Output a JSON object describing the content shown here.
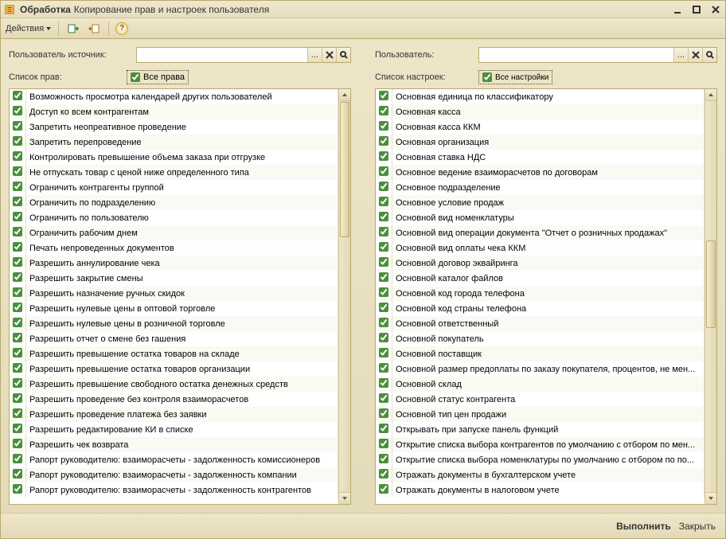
{
  "window": {
    "title": "Обработка",
    "subtitle": "Копирование прав и настроек пользователя"
  },
  "toolbar": {
    "actions_label": "Действия"
  },
  "left": {
    "user_label": "Пользователь источник:",
    "list_label": "Список прав:",
    "all_label": "Все права",
    "items": [
      "Возможность просмотра календарей других пользователей",
      "Доступ ко всем контрагентам",
      "Запретить неопреативное проведение",
      "Запретить перепроведение",
      "Контролировать превышение объема заказа при отгрузке",
      "Не отпускать товар с ценой ниже определенного типа",
      "Ограничить контрагенты группой",
      "Ограничить по подразделению",
      "Ограничить по пользователю",
      "Ограничить рабочим днем",
      "Печать непроведенных документов",
      "Разрешить аннулирование чека",
      "Разрешить закрытие смены",
      "Разрешить назначение ручных скидок",
      "Разрешить нулевые цены в оптовой торговле",
      "Разрешить нулевые цены в розничной торговле",
      "Разрешить отчет о смене без гашения",
      "Разрешить превышение остатка товаров на складе",
      "Разрешить превышение остатка товаров организации",
      "Разрешить превышение свободного остатка денежных средств",
      "Разрешить проведение без контроля взаиморасчетов",
      "Разрешить проведение платежа без заявки",
      "Разрешить редактирование КИ в списке",
      "Разрешить чек возврата",
      "Рапорт руководителю: взаиморасчеты - задолженность комиссионеров",
      "Рапорт руководителю: взаиморасчеты - задолженность компании",
      "Рапорт руководителю: взаиморасчеты - задолженность контрагентов"
    ]
  },
  "right": {
    "user_label": "Пользователь:",
    "list_label": "Список настроек:",
    "all_label": "Все настройки",
    "items": [
      "Основная единица по классификатору",
      "Основная касса",
      "Основная касса ККМ",
      "Основная организация",
      "Основная ставка НДС",
      "Основное ведение взаиморасчетов по договорам",
      "Основное подразделение",
      "Основное условие продаж",
      "Основной вид номенклатуры",
      "Основной вид операции документа \"Отчет о розничных продажах\"",
      "Основной вид оплаты чека ККМ",
      "Основной договор эквайринга",
      "Основной каталог файлов",
      "Основной код города телефона",
      "Основной код страны телефона",
      "Основной ответственный",
      "Основной покупатель",
      "Основной поставщик",
      "Основной размер предоплаты по заказу покупателя, процентов, не мен...",
      "Основной склад",
      "Основной статус контрагента",
      "Основной тип цен продажи",
      "Открывать при запуске панель функций",
      "Открытие списка выбора контрагентов по умолчанию с отбором по мен...",
      "Открытие списка выбора номенклатуры по умолчанию с отбором по по...",
      "Отражать документы в бухгалтерском учете",
      "Отражать документы в налоговом учете"
    ]
  },
  "footer": {
    "execute": "Выполнить",
    "close": "Закрыть"
  }
}
